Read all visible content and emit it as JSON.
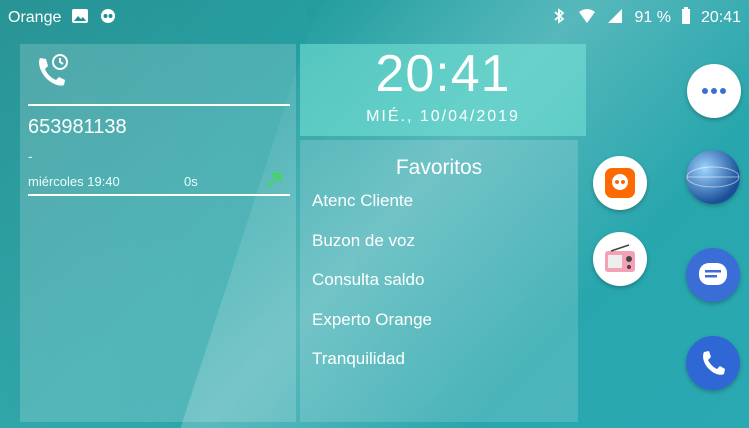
{
  "status_bar": {
    "carrier": "Orange",
    "battery_text": "91 %",
    "time": "20:41"
  },
  "call_log": {
    "number": "653981138",
    "dash": "-",
    "date": "miércoles 19:40",
    "duration": "0s"
  },
  "clock": {
    "time": "20:41",
    "date": "MIÉ., 10/04/2019"
  },
  "favorites": {
    "title": "Favoritos",
    "items": [
      {
        "label": "Atenc Cliente"
      },
      {
        "label": "Buzon de voz"
      },
      {
        "label": "Consulta saldo"
      },
      {
        "label": "Experto Orange"
      },
      {
        "label": "Tranquilidad"
      }
    ]
  },
  "apps": [
    {
      "icon": "orange-voicemail-icon"
    },
    {
      "icon": "radio-icon"
    },
    {
      "icon": "app-drawer-icon"
    },
    {
      "icon": "globe-browser-icon"
    },
    {
      "icon": "messages-icon"
    },
    {
      "icon": "phone-icon"
    }
  ],
  "colors": {
    "accent_orange": "#ff6a00",
    "call_arrow": "#3fdc4a",
    "phone_blue": "#2f67d4"
  }
}
